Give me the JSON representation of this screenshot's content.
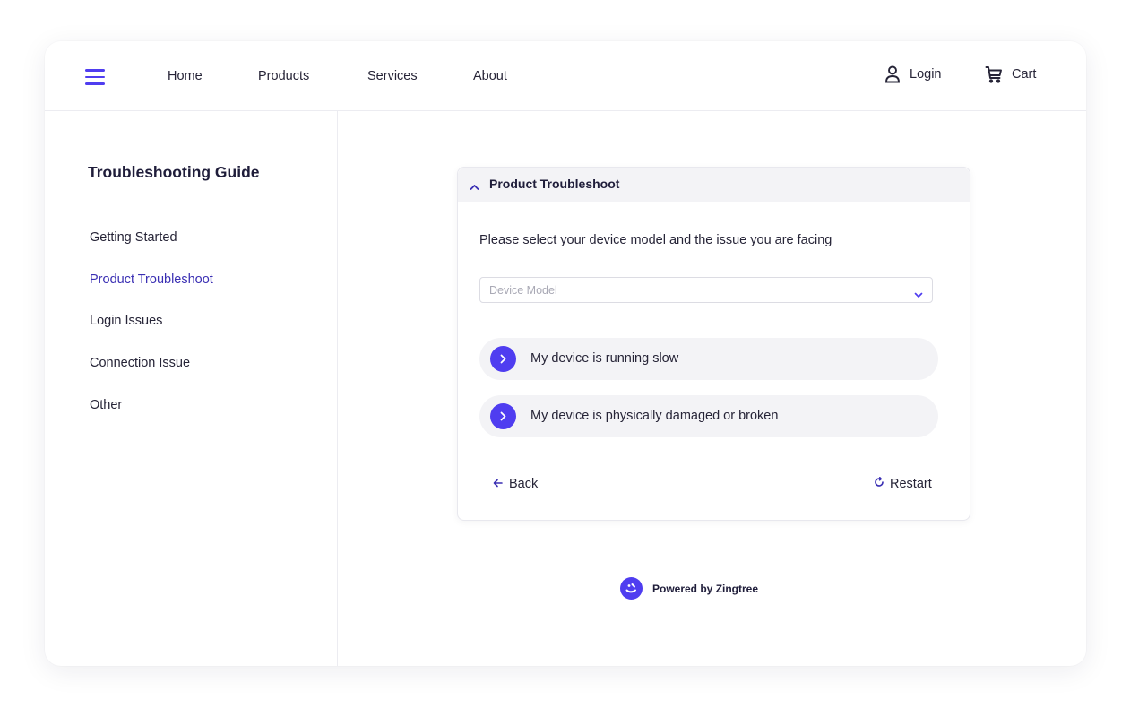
{
  "nav": {
    "links": [
      "Home",
      "Products",
      "Services",
      "About"
    ],
    "login": "Login",
    "cart": "Cart",
    "icons": {
      "menu": "hamburger-icon",
      "login": "user-icon",
      "cart": "cart-icon"
    }
  },
  "sidebar": {
    "title": "Troubleshooting Guide",
    "items": [
      {
        "label": "Getting Started",
        "active": false
      },
      {
        "label": "Product Troubleshoot",
        "active": true
      },
      {
        "label": "Login Issues",
        "active": false
      },
      {
        "label": "Connection Issue",
        "active": false
      },
      {
        "label": "Other",
        "active": false
      }
    ]
  },
  "card": {
    "title": "Product Troubleshoot",
    "prompt": "Please select your device model and the issue you are facing",
    "select_placeholder": "Device Model",
    "options": [
      "My device is running slow",
      "My device is physically damaged or broken"
    ],
    "back": "Back",
    "restart": "Restart"
  },
  "footer": {
    "powered_by": "Powered by Zingtree"
  },
  "colors": {
    "accent": "#4f3df0",
    "active_link": "#3a2fb3",
    "text": "#262437",
    "panel": "#f3f3f6"
  }
}
